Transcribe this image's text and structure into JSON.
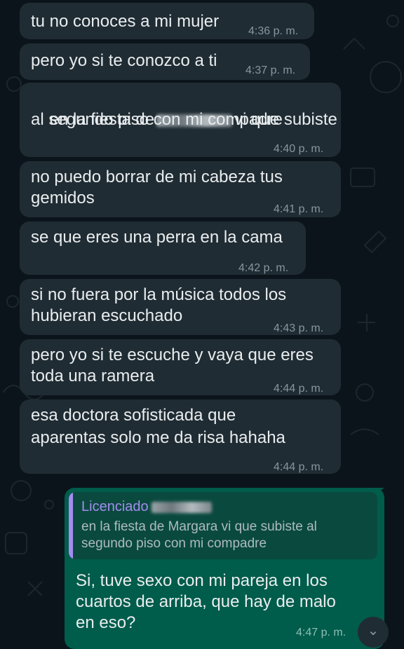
{
  "messages": [
    {
      "text": "tu no conoces a mi mujer",
      "time": "4:36 p. m."
    },
    {
      "text": "pero yo si te conozco a ti",
      "time": "4:37 p. m."
    },
    {
      "text_before": "en la fiesta de",
      "text_after": "vi que subiste",
      "line2": "al segundo piso con mi compadre",
      "time": "4:40 p. m."
    },
    {
      "line1": "no puedo borrar de mi cabeza tus",
      "line2": "gemidos",
      "time": "4:41 p. m."
    },
    {
      "text": "se que eres una perra en la cama",
      "time": "4:42 p. m."
    },
    {
      "line1": "si no fuera por la música todos los",
      "line2": "hubieran escuchado",
      "time": "4:43 p. m."
    },
    {
      "line1": "pero yo si te escuche y vaya que eres",
      "line2": "toda una ramera",
      "time": "4:44 p. m."
    },
    {
      "line1": "esa doctora sofisticada que",
      "line2": "aparentas solo me da risa hahaha",
      "time": "4:44 p. m."
    }
  ],
  "reply": {
    "quoted_author": "Licenciado",
    "quoted_text": "en la fiesta de Margara vi que subiste al segundo piso con mi compadre",
    "body": "Si, tuve sexo con mi pareja en los\ncuartos de arriba, que hay de malo\nen eso?",
    "time": "4:47 p. m."
  },
  "icons": {
    "scroll_down": "chevron-down-icon",
    "wallpaper": "doodle-pattern"
  },
  "colors": {
    "incoming_bubble": "#202c33",
    "outgoing_bubble": "#005c4b",
    "quote_accent": "#a48cf0",
    "background": "#0b141a"
  }
}
